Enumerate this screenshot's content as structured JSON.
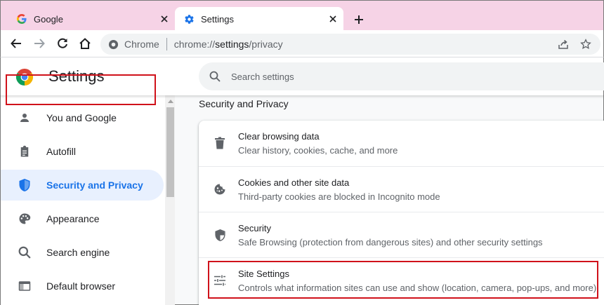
{
  "tabs": [
    {
      "label": "Google",
      "icon": "google-g-icon"
    },
    {
      "label": "Settings",
      "icon": "gear-icon",
      "active": true
    }
  ],
  "toolbar": {
    "site_label": "Chrome",
    "url_prefix": "chrome://",
    "url_path": "settings",
    "url_suffix": "/privacy"
  },
  "header": {
    "title": "Settings",
    "search_placeholder": "Search settings"
  },
  "sidebar": {
    "items": [
      {
        "label": "You and Google",
        "icon": "person-icon"
      },
      {
        "label": "Autofill",
        "icon": "clipboard-icon"
      },
      {
        "label": "Security and Privacy",
        "icon": "shield-icon",
        "active": true
      },
      {
        "label": "Appearance",
        "icon": "palette-icon"
      },
      {
        "label": "Search engine",
        "icon": "search-icon"
      },
      {
        "label": "Default browser",
        "icon": "browser-window-icon"
      }
    ]
  },
  "main": {
    "section_title": "Security and Privacy",
    "rows": [
      {
        "title": "Clear browsing data",
        "subtitle": "Clear history, cookies, cache, and more",
        "icon": "trash-icon"
      },
      {
        "title": "Cookies and other site data",
        "subtitle": "Third-party cookies are blocked in Incognito mode",
        "icon": "cookie-icon"
      },
      {
        "title": "Security",
        "subtitle": "Safe Browsing (protection from dangerous sites) and other security settings",
        "icon": "shield-icon"
      },
      {
        "title": "Site Settings",
        "subtitle": "Controls what information sites can use and show (location, camera, pop-ups, and more)",
        "icon": "sliders-icon"
      }
    ]
  },
  "colors": {
    "tab_strip": "#f6d3e6",
    "accent": "#1a73e8",
    "highlight": "#d0121b"
  }
}
